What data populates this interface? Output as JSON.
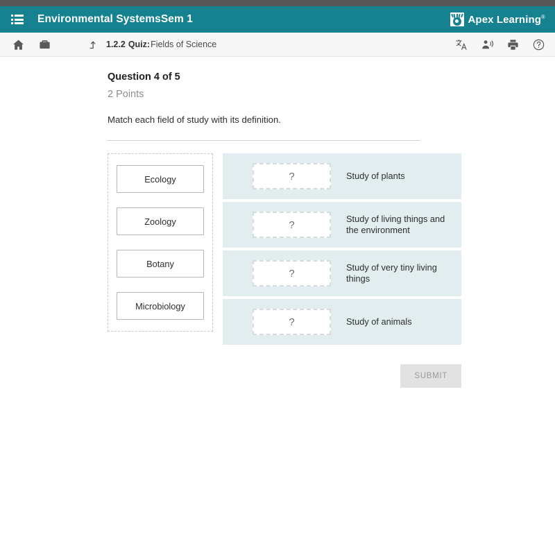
{
  "header": {
    "menu_icon": "list-menu-icon",
    "course_title": "Environmental SystemsSem 1",
    "brand_name": "Apex Learning",
    "brand_trademark": "®",
    "brand_mark_icon": "apex-torch-logo-icon",
    "accent_color": "#16818f",
    "top_strip_color": "#565656"
  },
  "toolbar": {
    "home_icon": "home-icon",
    "briefcase_icon": "briefcase-icon",
    "exit_icon": "up-level-arrow-icon",
    "activity_number": "1.2.2",
    "activity_kind": "Quiz:",
    "activity_name": "Fields of Science",
    "translate_icon": "translate-icon",
    "read_aloud_icon": "text-to-speech-icon",
    "print_icon": "print-icon",
    "help_icon": "help-circle-icon"
  },
  "question": {
    "title": "Question 4 of 5",
    "points": "2 Points",
    "prompt": "Match each field of study with its definition."
  },
  "bank": {
    "items": [
      {
        "label": "Ecology"
      },
      {
        "label": "Zoology"
      },
      {
        "label": "Botany"
      },
      {
        "label": "Microbiology"
      }
    ]
  },
  "targets": {
    "placeholder": "?",
    "rows": [
      {
        "definition": "Study of plants"
      },
      {
        "definition": "Study of living things and the environment"
      },
      {
        "definition": "Study of very tiny living things"
      },
      {
        "definition": "Study of animals"
      }
    ]
  },
  "actions": {
    "submit_label": "SUBMIT",
    "submit_disabled_color": "#e2e2e2"
  }
}
